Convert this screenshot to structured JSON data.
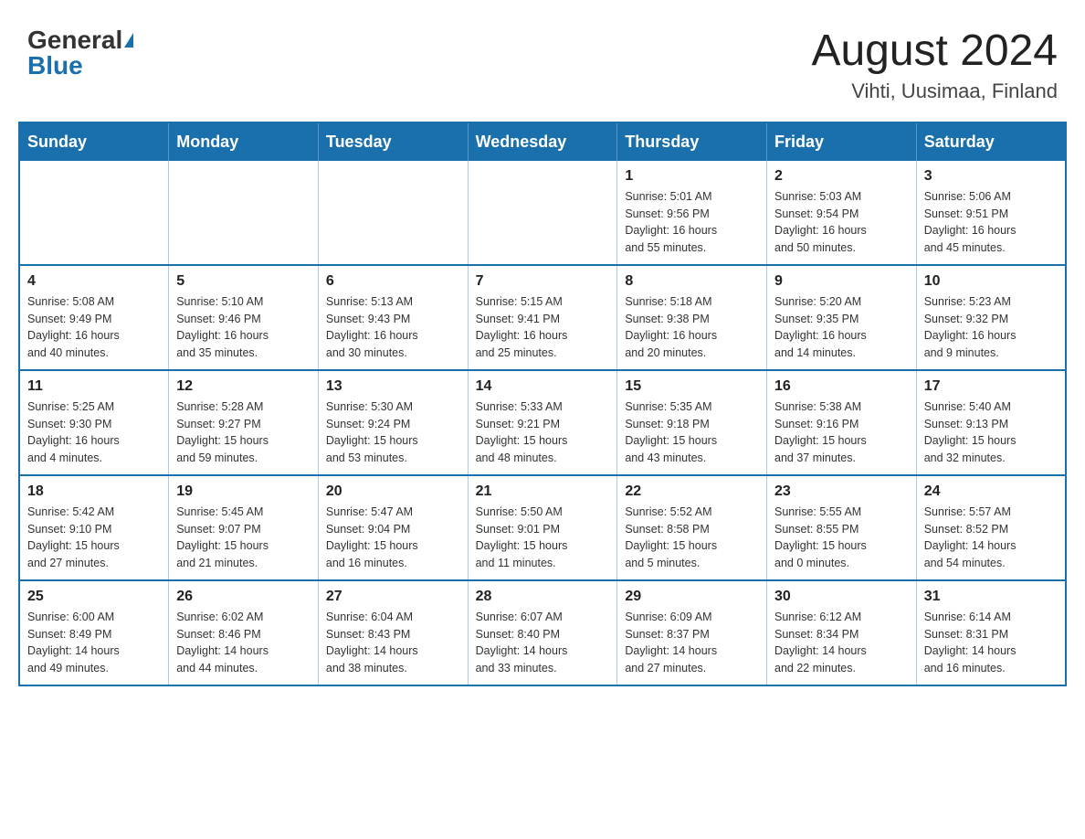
{
  "header": {
    "logo_general": "General",
    "logo_blue": "Blue",
    "month_title": "August 2024",
    "location": "Vihti, Uusimaa, Finland"
  },
  "days_of_week": [
    "Sunday",
    "Monday",
    "Tuesday",
    "Wednesday",
    "Thursday",
    "Friday",
    "Saturday"
  ],
  "weeks": [
    [
      {
        "day": "",
        "info": ""
      },
      {
        "day": "",
        "info": ""
      },
      {
        "day": "",
        "info": ""
      },
      {
        "day": "",
        "info": ""
      },
      {
        "day": "1",
        "info": "Sunrise: 5:01 AM\nSunset: 9:56 PM\nDaylight: 16 hours\nand 55 minutes."
      },
      {
        "day": "2",
        "info": "Sunrise: 5:03 AM\nSunset: 9:54 PM\nDaylight: 16 hours\nand 50 minutes."
      },
      {
        "day": "3",
        "info": "Sunrise: 5:06 AM\nSunset: 9:51 PM\nDaylight: 16 hours\nand 45 minutes."
      }
    ],
    [
      {
        "day": "4",
        "info": "Sunrise: 5:08 AM\nSunset: 9:49 PM\nDaylight: 16 hours\nand 40 minutes."
      },
      {
        "day": "5",
        "info": "Sunrise: 5:10 AM\nSunset: 9:46 PM\nDaylight: 16 hours\nand 35 minutes."
      },
      {
        "day": "6",
        "info": "Sunrise: 5:13 AM\nSunset: 9:43 PM\nDaylight: 16 hours\nand 30 minutes."
      },
      {
        "day": "7",
        "info": "Sunrise: 5:15 AM\nSunset: 9:41 PM\nDaylight: 16 hours\nand 25 minutes."
      },
      {
        "day": "8",
        "info": "Sunrise: 5:18 AM\nSunset: 9:38 PM\nDaylight: 16 hours\nand 20 minutes."
      },
      {
        "day": "9",
        "info": "Sunrise: 5:20 AM\nSunset: 9:35 PM\nDaylight: 16 hours\nand 14 minutes."
      },
      {
        "day": "10",
        "info": "Sunrise: 5:23 AM\nSunset: 9:32 PM\nDaylight: 16 hours\nand 9 minutes."
      }
    ],
    [
      {
        "day": "11",
        "info": "Sunrise: 5:25 AM\nSunset: 9:30 PM\nDaylight: 16 hours\nand 4 minutes."
      },
      {
        "day": "12",
        "info": "Sunrise: 5:28 AM\nSunset: 9:27 PM\nDaylight: 15 hours\nand 59 minutes."
      },
      {
        "day": "13",
        "info": "Sunrise: 5:30 AM\nSunset: 9:24 PM\nDaylight: 15 hours\nand 53 minutes."
      },
      {
        "day": "14",
        "info": "Sunrise: 5:33 AM\nSunset: 9:21 PM\nDaylight: 15 hours\nand 48 minutes."
      },
      {
        "day": "15",
        "info": "Sunrise: 5:35 AM\nSunset: 9:18 PM\nDaylight: 15 hours\nand 43 minutes."
      },
      {
        "day": "16",
        "info": "Sunrise: 5:38 AM\nSunset: 9:16 PM\nDaylight: 15 hours\nand 37 minutes."
      },
      {
        "day": "17",
        "info": "Sunrise: 5:40 AM\nSunset: 9:13 PM\nDaylight: 15 hours\nand 32 minutes."
      }
    ],
    [
      {
        "day": "18",
        "info": "Sunrise: 5:42 AM\nSunset: 9:10 PM\nDaylight: 15 hours\nand 27 minutes."
      },
      {
        "day": "19",
        "info": "Sunrise: 5:45 AM\nSunset: 9:07 PM\nDaylight: 15 hours\nand 21 minutes."
      },
      {
        "day": "20",
        "info": "Sunrise: 5:47 AM\nSunset: 9:04 PM\nDaylight: 15 hours\nand 16 minutes."
      },
      {
        "day": "21",
        "info": "Sunrise: 5:50 AM\nSunset: 9:01 PM\nDaylight: 15 hours\nand 11 minutes."
      },
      {
        "day": "22",
        "info": "Sunrise: 5:52 AM\nSunset: 8:58 PM\nDaylight: 15 hours\nand 5 minutes."
      },
      {
        "day": "23",
        "info": "Sunrise: 5:55 AM\nSunset: 8:55 PM\nDaylight: 15 hours\nand 0 minutes."
      },
      {
        "day": "24",
        "info": "Sunrise: 5:57 AM\nSunset: 8:52 PM\nDaylight: 14 hours\nand 54 minutes."
      }
    ],
    [
      {
        "day": "25",
        "info": "Sunrise: 6:00 AM\nSunset: 8:49 PM\nDaylight: 14 hours\nand 49 minutes."
      },
      {
        "day": "26",
        "info": "Sunrise: 6:02 AM\nSunset: 8:46 PM\nDaylight: 14 hours\nand 44 minutes."
      },
      {
        "day": "27",
        "info": "Sunrise: 6:04 AM\nSunset: 8:43 PM\nDaylight: 14 hours\nand 38 minutes."
      },
      {
        "day": "28",
        "info": "Sunrise: 6:07 AM\nSunset: 8:40 PM\nDaylight: 14 hours\nand 33 minutes."
      },
      {
        "day": "29",
        "info": "Sunrise: 6:09 AM\nSunset: 8:37 PM\nDaylight: 14 hours\nand 27 minutes."
      },
      {
        "day": "30",
        "info": "Sunrise: 6:12 AM\nSunset: 8:34 PM\nDaylight: 14 hours\nand 22 minutes."
      },
      {
        "day": "31",
        "info": "Sunrise: 6:14 AM\nSunset: 8:31 PM\nDaylight: 14 hours\nand 16 minutes."
      }
    ]
  ]
}
